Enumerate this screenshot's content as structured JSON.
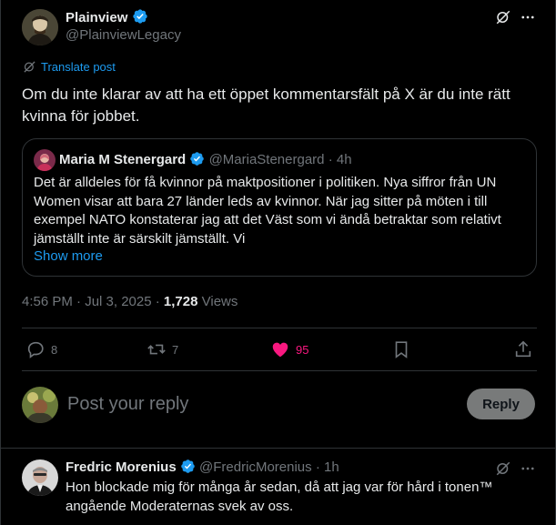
{
  "post": {
    "author_name": "Plainview",
    "author_handle": "@PlainviewLegacy",
    "translate_label": "Translate post",
    "text": "Om du inte klarar av att ha ett öppet kommentarsfält på X är du inte rätt kvinna för jobbet.",
    "timestamp": "4:56 PM · Jul 3, 2025 · ",
    "views_count": "1,728",
    "views_label": " Views"
  },
  "quote": {
    "author_name": "Maria M Stenergard",
    "author_handle": "@MariaStenergard",
    "separator": "·",
    "time": "4h",
    "text": "Det är alldeles för få kvinnor på maktpositioner i politiken. Nya siffror från UN Women visar att bara 27 länder leds av kvinnor. När jag sitter på möten i till exempel NATO konstaterar jag att det Väst som vi ändå betraktar som relativt jämställt inte är särskilt jämställt. Vi",
    "show_more": "Show more"
  },
  "actions": {
    "replies": "8",
    "reposts": "7",
    "likes": "95"
  },
  "composer": {
    "placeholder": "Post your reply",
    "reply_button": "Reply"
  },
  "reply": {
    "author_name": "Fredric Morenius",
    "author_handle": "@FredricMorenius",
    "separator": "·",
    "time": "1h",
    "text": "Hon blockade mig för många år sedan, då att jag var för hård i tonen™ angående Moderaternas svek av oss."
  },
  "colors": {
    "background": "#000000",
    "text": "#e7e9ea",
    "muted": "#71767b",
    "accent": "#1d9bf0",
    "like": "#f91880",
    "border": "#2f3336"
  },
  "icons": [
    "verified-badge-icon",
    "grok-icon",
    "more-icon",
    "translate-icon",
    "reply-icon",
    "repost-icon",
    "heart-icon",
    "bookmark-icon",
    "share-icon"
  ]
}
